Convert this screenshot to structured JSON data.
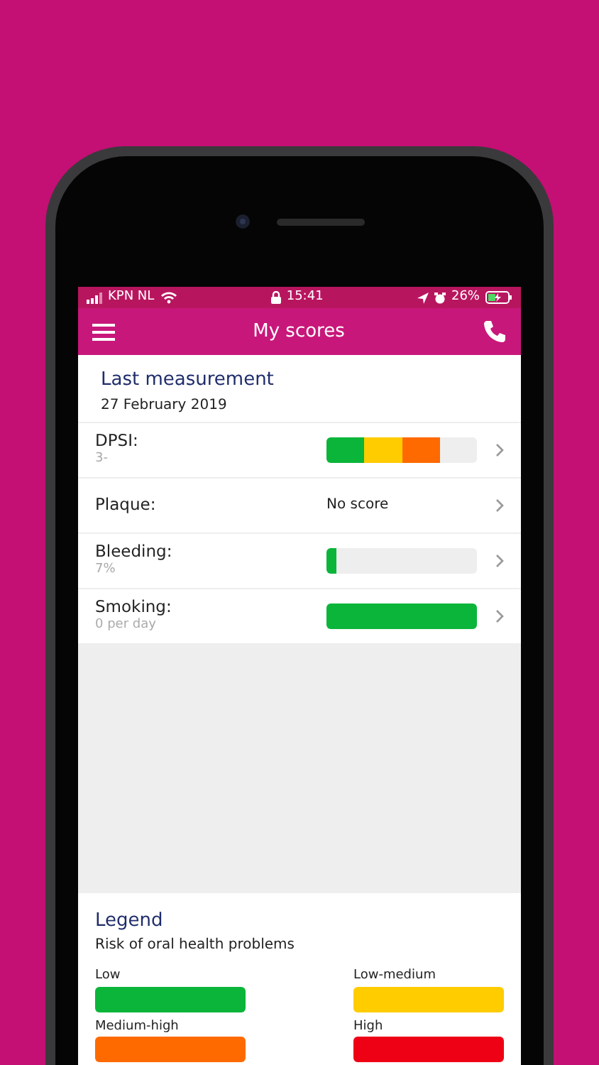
{
  "status_bar": {
    "carrier": "KPN NL",
    "time": "15:41",
    "battery": "26%"
  },
  "header": {
    "title": "My scores"
  },
  "measurement": {
    "title": "Last measurement",
    "date": "27 February 2019"
  },
  "scores": [
    {
      "kind": "segments",
      "label": "DPSI:",
      "detail": "3-",
      "level": 0.75
    },
    {
      "kind": "text",
      "label": "Plaque:",
      "value": "No score"
    },
    {
      "kind": "bar",
      "label": "Bleeding:",
      "detail": "7%",
      "color": "#0bb53a",
      "level": 0.07
    },
    {
      "kind": "bar",
      "label": "Smoking:",
      "detail": "0 per day",
      "color": "#0bb53a",
      "level": 1.0
    }
  ],
  "legend": {
    "title": "Legend",
    "subtitle": "Risk of oral health problems",
    "items": [
      {
        "label": "Low",
        "color": "#0bb53a"
      },
      {
        "label": "Low-medium",
        "color": "#ffcc00"
      },
      {
        "label": "Medium-high",
        "color": "#ff6a00"
      },
      {
        "label": "High",
        "color": "#ee0015"
      }
    ]
  }
}
